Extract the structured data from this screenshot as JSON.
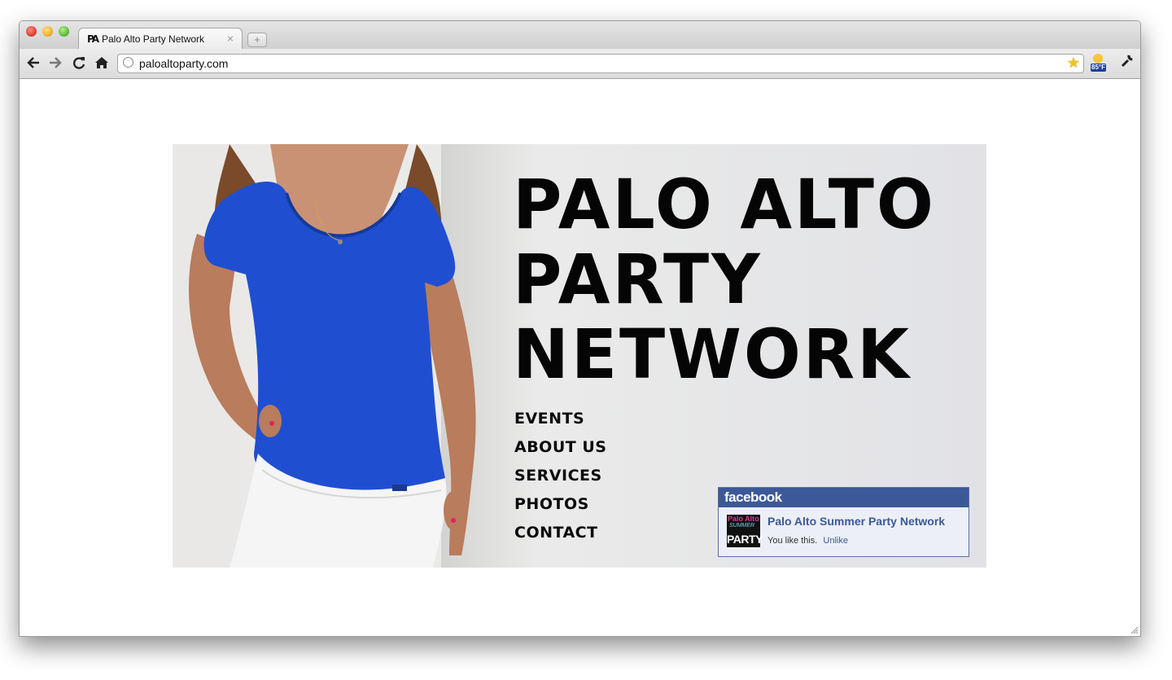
{
  "browser": {
    "tab_title": "Palo Alto Party Network",
    "tab_favicon_text": "PA",
    "tab_close_glyph": "×",
    "new_tab_glyph": "+",
    "url": "paloaltoparty.com",
    "weather_badge": "85°F",
    "icons": [
      "back-arrow-icon",
      "forward-arrow-icon",
      "reload-icon",
      "home-icon",
      "globe-icon",
      "bookmark-star-icon",
      "weather-icon",
      "wrench-icon"
    ]
  },
  "page": {
    "title_line_1": "PALO ALTO",
    "title_line_2": "PARTY",
    "title_line_3": "NETWORK",
    "nav": [
      "EVENTS",
      "ABOUT US",
      "SERVICES",
      "PHOTOS",
      "CONTACT"
    ]
  },
  "facebook": {
    "header": "facebook",
    "page_name": "Palo Alto Summer Party Network",
    "likes_text": "You like this.",
    "unlike_label": "Unlike",
    "thumb_line_1": "Palo Alto",
    "thumb_line_2": "SUMMER",
    "thumb_line_3": "PARTY"
  },
  "colors": {
    "shirt_blue": "#1f4fd0",
    "facebook_blue": "#3b5998",
    "title_black": "#050505"
  }
}
